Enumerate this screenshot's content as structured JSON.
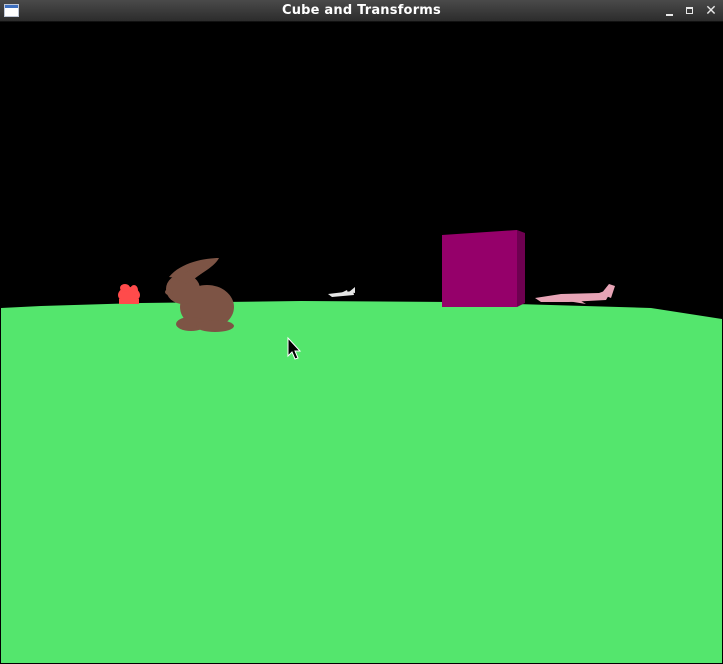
{
  "window": {
    "title": "Cube and Transforms",
    "icons": {
      "app": "app-window-icon",
      "minimize": "minimize-icon",
      "maximize": "maximize-icon",
      "close": "close-icon"
    },
    "close_glyph": "✕"
  },
  "scene": {
    "sky_color": "#000000",
    "ground_color": "#54e66d",
    "cube_color": "#95006a",
    "bunny_color": "#7d5445",
    "red_model_color": "#ff4b4b",
    "jet_color": "#e7a4b6",
    "small_plane_color": "#e6e6e6"
  }
}
